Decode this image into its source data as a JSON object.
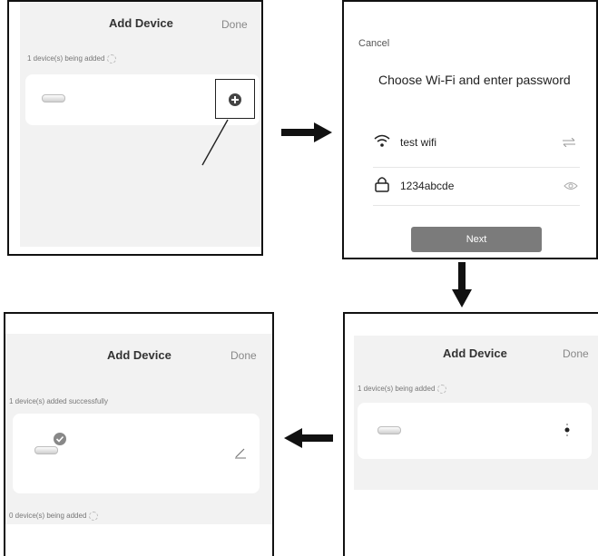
{
  "step1": {
    "title": "Add Device",
    "done": "Done",
    "status": "1 device(s) being added",
    "add_icon": "plus-circle-icon"
  },
  "step2": {
    "cancel": "Cancel",
    "heading": "Choose Wi-Fi and enter password",
    "wifi_name": "test wifi",
    "password": "1234abcde",
    "next": "Next",
    "wifi_icon": "wifi-icon",
    "lock_icon": "lock-icon",
    "switch_icon": "swap-icon",
    "eye_icon": "eye-icon"
  },
  "step3": {
    "title": "Add Device",
    "done": "Done",
    "status": "1 device(s) being added"
  },
  "step4": {
    "title": "Add Device",
    "done": "Done",
    "status_success": "1 device(s) added successfully",
    "status_adding": "0 device(s) being added",
    "edit_icon": "pencil-icon",
    "check_icon": "check-badge-icon"
  },
  "colors": {
    "screen_bg": "#f2f2f2",
    "next_button": "#7b7b7b",
    "border": "#111111"
  }
}
